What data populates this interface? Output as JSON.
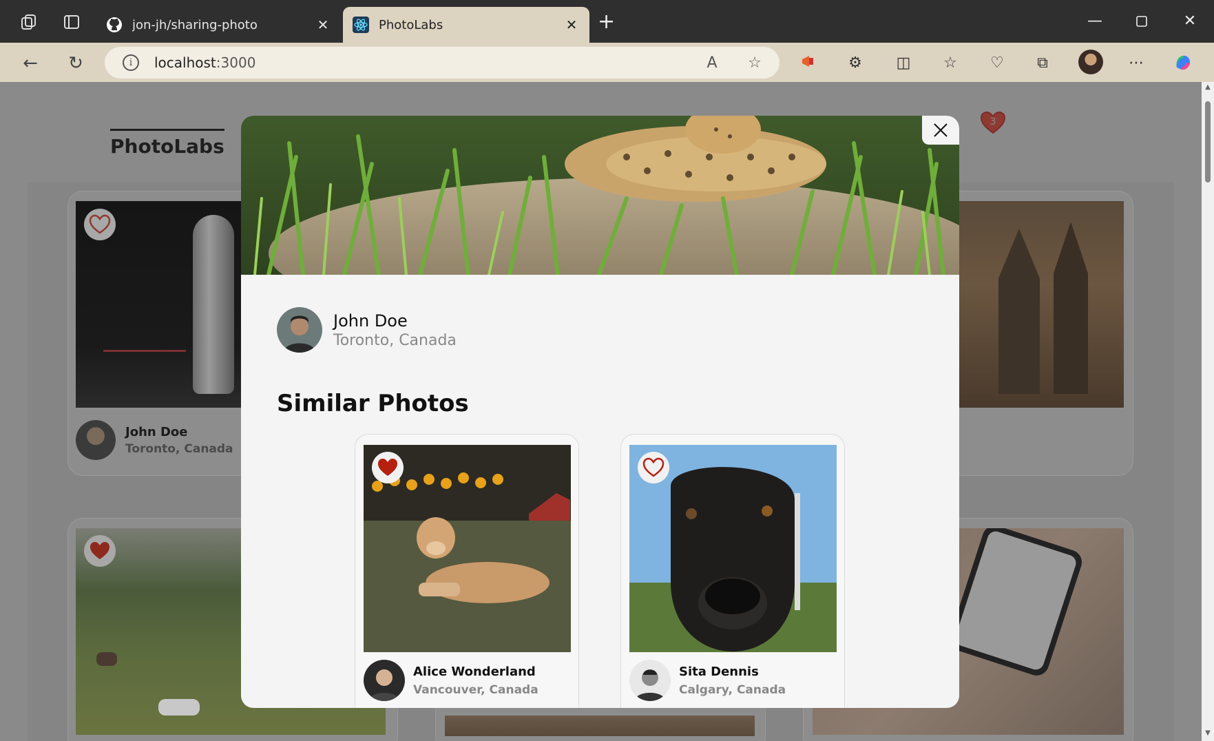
{
  "browser": {
    "tabs": [
      {
        "title": "jon-jh/sharing-photo",
        "active": false,
        "favicon": "github-icon"
      },
      {
        "title": "PhotoLabs",
        "active": true,
        "favicon": "react-icon"
      }
    ],
    "address": {
      "host": "localhost",
      "port": ":3000"
    }
  },
  "app": {
    "logo": "PhotoLabs",
    "favorites_count": "3"
  },
  "background_cards": [
    {
      "name": "John Doe",
      "location": "Toronto, Canada",
      "liked": false
    }
  ],
  "modal": {
    "user": {
      "name": "John Doe",
      "location": "Toronto, Canada"
    },
    "similar_title": "Similar Photos",
    "similar": [
      {
        "name": "Alice Wonderland",
        "location": "Vancouver, Canada",
        "liked": true
      },
      {
        "name": "Sita Dennis",
        "location": "Calgary, Canada",
        "liked": false
      }
    ]
  },
  "colors": {
    "heart_red": "#b5200f",
    "overlay": "#8a8a8a",
    "tab_active": "#ddd3c1"
  }
}
